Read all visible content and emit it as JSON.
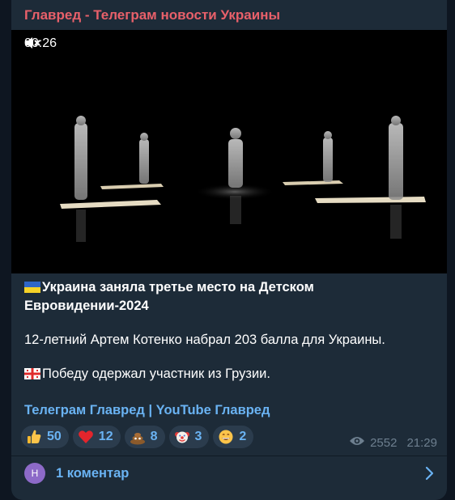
{
  "channel": {
    "name": "Главред - Телеграм новости Украины"
  },
  "video": {
    "time": "00:26",
    "sound_icon": "mute-icon"
  },
  "post": {
    "headline": "Украина заняла третье место на Детском Евровидении-2024",
    "paragraph1": "12-летний Артем Котенко набрал 203 балла для Украины.",
    "paragraph2": "Победу одержал участник из Грузии."
  },
  "links": {
    "telegram": "Телеграм Главред",
    "separator": "|",
    "youtube": "YouTube Главред"
  },
  "reactions": [
    {
      "icon": "thumbs-up-icon",
      "count": "50"
    },
    {
      "icon": "red-heart-icon",
      "count": "12"
    },
    {
      "icon": "poop-icon",
      "count": "8"
    },
    {
      "icon": "clown-icon",
      "count": "3"
    },
    {
      "icon": "grin-icon",
      "count": "2"
    }
  ],
  "meta": {
    "views": "2552",
    "time": "21:29"
  },
  "comments": {
    "avatar_letter": "H",
    "label": "1 коментар"
  },
  "colors": {
    "background": "#0e1621",
    "card": "#1d2b38",
    "channel": "#e8606a",
    "link": "#6ab3f3"
  }
}
